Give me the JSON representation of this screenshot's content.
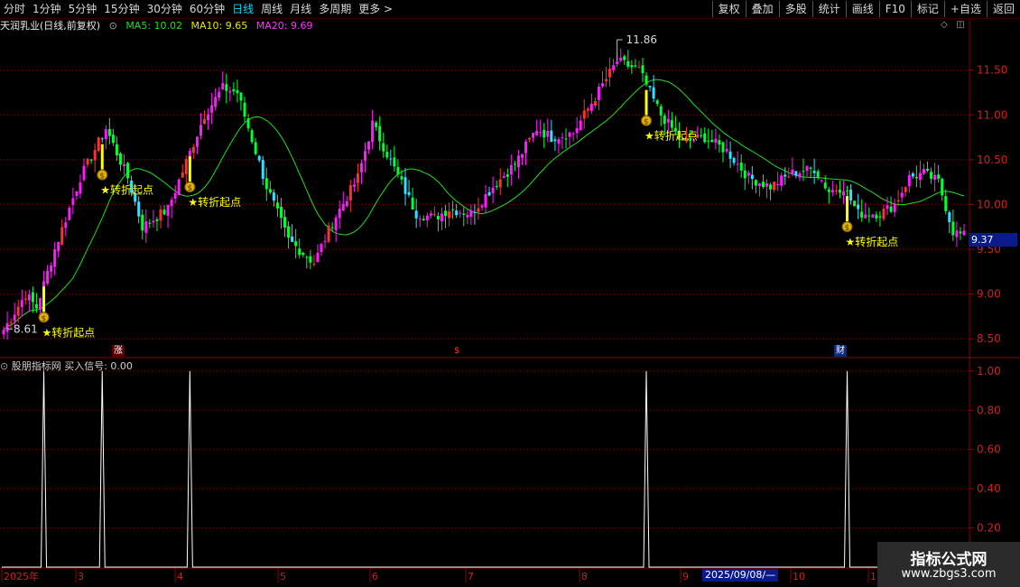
{
  "toolbar": {
    "left_items": [
      "分时",
      "1分钟",
      "5分钟",
      "15分钟",
      "30分钟",
      "60分钟",
      "日线",
      "周线",
      "月线",
      "多周期",
      "更多 >"
    ],
    "active_index": 6,
    "right_items": [
      "复权",
      "叠加",
      "多股",
      "统计",
      "画线",
      "F10",
      "标记",
      "+自选",
      "返回"
    ]
  },
  "main_panel": {
    "stock_title": "天润乳业(日线,前复权)",
    "ma5": "MA5: 10.02",
    "ma10": "MA10: 9.65",
    "ma20": "MA20: 9.69",
    "high_label": "11.86",
    "low_label": "8.61",
    "current_price": "9.37",
    "y_ticks": [
      "11.50",
      "11.00",
      "10.50",
      "10.00",
      "9.50",
      "9.00",
      "8.50"
    ],
    "signal_label": "★转折起点",
    "markers": [
      {
        "text": "涨"
      },
      {
        "text": "$"
      },
      {
        "text": "财"
      }
    ]
  },
  "sub_panel": {
    "title": "股朋指标网 买入信号: 0.00",
    "y_ticks": [
      "1.00",
      "0.80",
      "0.60",
      "0.40",
      "0.20"
    ]
  },
  "x_axis": {
    "labels": [
      "2025年",
      "3",
      "4",
      "5",
      "6",
      "7",
      "8",
      "9",
      "10",
      "1"
    ],
    "cursor_date": "2025/09/08/—"
  },
  "watermark": {
    "line1": "指标公式网",
    "line2": "www.zbgs3.com"
  },
  "colors": {
    "up": "#ff1aff",
    "down": "#00ff33",
    "up_hollow": "#ff3030",
    "down_thin": "#33e0ff",
    "ma_line": "#22dd22",
    "grid": "#8b0000",
    "signal": "#ffff00"
  },
  "chart_data": {
    "type": "candlestick",
    "series": [
      {
        "name": "MA5",
        "values": [
          10.02
        ]
      },
      {
        "name": "MA10",
        "values": [
          9.65
        ]
      },
      {
        "name": "MA20",
        "values": [
          9.69
        ]
      }
    ],
    "ylim": [
      8.3,
      11.9
    ],
    "pivot_points": [
      {
        "i": 0,
        "price": 8.6
      },
      {
        "i": 6,
        "price": 9.0
      },
      {
        "i": 9,
        "price": 8.85
      },
      {
        "i": 14,
        "price": 9.5
      },
      {
        "i": 21,
        "price": 10.3
      },
      {
        "i": 28,
        "price": 10.85
      },
      {
        "i": 34,
        "price": 10.3
      },
      {
        "i": 38,
        "price": 9.75
      },
      {
        "i": 45,
        "price": 9.95
      },
      {
        "i": 55,
        "price": 11.0
      },
      {
        "i": 60,
        "price": 11.3
      },
      {
        "i": 64,
        "price": 11.25
      },
      {
        "i": 72,
        "price": 10.2
      },
      {
        "i": 78,
        "price": 9.6
      },
      {
        "i": 85,
        "price": 9.35
      },
      {
        "i": 90,
        "price": 9.8
      },
      {
        "i": 97,
        "price": 10.3
      },
      {
        "i": 101,
        "price": 10.9
      },
      {
        "i": 107,
        "price": 10.4
      },
      {
        "i": 113,
        "price": 9.9
      },
      {
        "i": 118,
        "price": 9.85
      },
      {
        "i": 122,
        "price": 9.95
      },
      {
        "i": 128,
        "price": 9.9
      },
      {
        "i": 134,
        "price": 10.2
      },
      {
        "i": 140,
        "price": 10.45
      },
      {
        "i": 146,
        "price": 10.85
      },
      {
        "i": 150,
        "price": 10.75
      },
      {
        "i": 156,
        "price": 10.8
      },
      {
        "i": 162,
        "price": 11.2
      },
      {
        "i": 168,
        "price": 11.6
      },
      {
        "i": 174,
        "price": 11.5
      },
      {
        "i": 180,
        "price": 11.0
      },
      {
        "i": 186,
        "price": 10.7
      },
      {
        "i": 192,
        "price": 10.75
      },
      {
        "i": 198,
        "price": 10.6
      },
      {
        "i": 204,
        "price": 10.3
      },
      {
        "i": 210,
        "price": 10.2
      },
      {
        "i": 216,
        "price": 10.35
      },
      {
        "i": 222,
        "price": 10.4
      },
      {
        "i": 226,
        "price": 10.15
      },
      {
        "i": 230,
        "price": 10.2
      },
      {
        "i": 234,
        "price": 9.9
      },
      {
        "i": 240,
        "price": 9.9
      },
      {
        "i": 244,
        "price": 10.0
      },
      {
        "i": 248,
        "price": 10.3
      },
      {
        "i": 252,
        "price": 10.35
      },
      {
        "i": 256,
        "price": 10.25
      },
      {
        "i": 260,
        "price": 9.7
      },
      {
        "i": 263,
        "price": 9.65
      }
    ],
    "buy_signal_bars": [
      11,
      27,
      51,
      176,
      231
    ],
    "signal_values": [
      1.0,
      1.0,
      1.0,
      1.0,
      1.0
    ],
    "sub_ylim": [
      0,
      1.05
    ]
  }
}
